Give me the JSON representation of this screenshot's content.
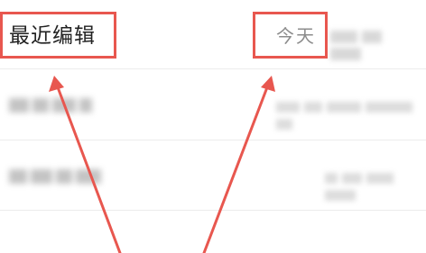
{
  "header": {
    "section_title": "最近编辑",
    "date_label": "今天"
  },
  "annotation": {
    "box_color": "#e8574f",
    "arrow_color": "#e8574f"
  },
  "colors": {
    "title": "#222222",
    "date": "#8c8c8c",
    "divider": "#ececec"
  }
}
